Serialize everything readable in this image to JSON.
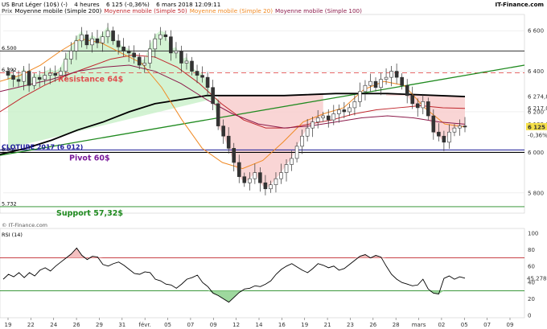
{
  "header": {
    "instrument": "US Brut Léger (10$) (-)",
    "timeframe": "4 heures",
    "price_change": "6 125 (-0,36%)",
    "datetime": "6 mars 2018 12:09:11",
    "source": "IT-Finance.com",
    "legend": [
      {
        "text": "Prix",
        "color": "#333333"
      },
      {
        "text": "Moyenne mobile (Simple 200)",
        "color": "#000000"
      },
      {
        "text": "Moyenne mobile (Simple 50)",
        "color": "#c0272d"
      },
      {
        "text": "Moyenne mobile (Simple 20)",
        "color": "#f08a24"
      },
      {
        "text": "Moyenne mobile (Simple 100)",
        "color": "#8b1a4a"
      }
    ]
  },
  "colors": {
    "candle": "#333333",
    "sma200": "#000000",
    "sma50": "#c0272d",
    "sma20": "#f08a24",
    "sma100": "#8b1a4a",
    "trendline": "#1f8a1f",
    "support": "#1f8a1f",
    "resistance": "#e05050",
    "pivot": "#1a1a9a",
    "green_fill": "#c8f0c8",
    "red_fill": "#f8d0d0"
  },
  "chart_data": [
    {
      "type": "candlestick",
      "title": "",
      "ylim": [
        5.7,
        6.68
      ],
      "y_ticks": [
        6.6,
        6.4,
        6.2,
        6.0,
        5.8
      ],
      "y_tick_labels": [
        "6 600",
        "6 400",
        "6 200",
        "6 000",
        "5 800"
      ],
      "x_tick_labels": [
        "19",
        "22",
        "24",
        "26",
        "29",
        "31",
        "févr.",
        "05",
        "07",
        "09",
        "12",
        "14",
        "16",
        "19",
        "21",
        "23",
        "26",
        "28",
        "mars",
        "02",
        "05",
        "07",
        "09"
      ],
      "levels": [
        {
          "name": "level-6500",
          "y": 6.5,
          "label": "6.500",
          "style": "solid",
          "color": "#333333"
        },
        {
          "name": "level-resistance",
          "y": 6.392,
          "label": "6.392",
          "annotation": "Résistance 64$",
          "style": "dashed",
          "color": "#e05050"
        },
        {
          "name": "level-cloture",
          "y": 6.012,
          "annotation": "CLOTURE 2017 (6 012)",
          "style": "solid",
          "color": "#1a1a9a"
        },
        {
          "name": "level-pivot",
          "y": 6.0,
          "label": "6.000",
          "annotation": "Pivot 60$",
          "style": "solid",
          "color": "#000000"
        },
        {
          "name": "level-support",
          "y": 5.732,
          "label": "5.732",
          "annotation": "Support 57,32$",
          "style": "solid",
          "color": "#1f8a1f"
        }
      ],
      "right_labels": [
        {
          "text": "6 274,8",
          "y": 6.2748,
          "color": "#000000"
        },
        {
          "text": "6 217,0",
          "y": 6.217,
          "color": "#c0272d"
        },
        {
          "text": "6 139,1",
          "y": 6.1391,
          "color": "#8b1a4a"
        },
        {
          "text": "6 125",
          "y": 6.125,
          "color": "#000000",
          "bg": "#f5e04a"
        },
        {
          "text": "-0,36%",
          "y": 6.085,
          "color": "#c0272d"
        }
      ],
      "trendline": [
        [
          0,
          5.985
        ],
        [
          1,
          6.43
        ]
      ],
      "series": [
        {
          "name": "Prix",
          "close": [
            6.38,
            6.36,
            6.35,
            6.4,
            6.33,
            6.37,
            6.36,
            6.38,
            6.39,
            6.38,
            6.4,
            6.46,
            6.5,
            6.55,
            6.58,
            6.53,
            6.56,
            6.54,
            6.57,
            6.6,
            6.55,
            6.52,
            6.5,
            6.49,
            6.47,
            6.43,
            6.44,
            6.51,
            6.56,
            6.58,
            6.57,
            6.49,
            6.5,
            6.44,
            6.45,
            6.4,
            6.38,
            6.37,
            6.32,
            6.24,
            6.13,
            6.08,
            6.02,
            5.95,
            5.88,
            5.85,
            5.87,
            5.9,
            5.85,
            5.82,
            5.84,
            5.87,
            5.9,
            5.94,
            5.97,
            6.03,
            6.08,
            6.12,
            6.15,
            6.17,
            6.18,
            6.16,
            6.19,
            6.21,
            6.2,
            6.22,
            6.25,
            6.3,
            6.33,
            6.35,
            6.32,
            6.36,
            6.37,
            6.4,
            6.37,
            6.33,
            6.28,
            6.24,
            6.22,
            6.25,
            6.18,
            6.1,
            6.08,
            6.05,
            6.1,
            6.12,
            6.13,
            6.125
          ]
        },
        {
          "name": "Moyenne mobile (Simple 200)",
          "values": [
            5.99,
            6.02,
            6.06,
            6.11,
            6.15,
            6.2,
            6.24,
            6.26,
            6.28,
            6.28,
            6.28,
            6.28,
            6.285,
            6.29,
            6.29,
            6.29,
            6.285,
            6.28,
            6.275
          ]
        },
        {
          "name": "Moyenne mobile (Simple 50)",
          "values": [
            6.2,
            6.27,
            6.33,
            6.38,
            6.42,
            6.46,
            6.48,
            6.47,
            6.42,
            6.34,
            6.24,
            6.16,
            6.12,
            6.12,
            6.14,
            6.16,
            6.19,
            6.21,
            6.22,
            6.23,
            6.22,
            6.217
          ]
        },
        {
          "name": "Moyenne mobile (Simple 20)",
          "values": [
            6.35,
            6.38,
            6.43,
            6.5,
            6.56,
            6.54,
            6.49,
            6.44,
            6.32,
            6.16,
            6.02,
            5.95,
            5.92,
            5.96,
            6.05,
            6.15,
            6.19,
            6.22,
            6.31,
            6.35,
            6.33,
            6.22,
            6.14,
            6.125
          ]
        },
        {
          "name": "Moyenne mobile (Simple 100)",
          "values": [
            6.3,
            6.33,
            6.36,
            6.4,
            6.42,
            6.43,
            6.4,
            6.34,
            6.26,
            6.19,
            6.14,
            6.12,
            6.13,
            6.15,
            6.17,
            6.18,
            6.17,
            6.15,
            6.139
          ]
        }
      ]
    },
    {
      "type": "line",
      "title": "RSI (14)",
      "ylim": [
        0,
        100
      ],
      "y_ticks": [
        100,
        80,
        60,
        40,
        20,
        0
      ],
      "y_tick_labels": [
        "100",
        "80",
        "60",
        "40",
        "20",
        "0"
      ],
      "overbought": 70,
      "oversold": 30,
      "last_value_label": "45,278",
      "series": [
        {
          "name": "RSI",
          "values": [
            44,
            50,
            47,
            52,
            46,
            52,
            48,
            55,
            58,
            54,
            60,
            65,
            70,
            75,
            82,
            73,
            68,
            72,
            71,
            62,
            60,
            63,
            65,
            61,
            56,
            51,
            50,
            53,
            52,
            44,
            42,
            38,
            37,
            33,
            38,
            44,
            46,
            49,
            40,
            35,
            27,
            24,
            20,
            16,
            22,
            28,
            32,
            33,
            36,
            35,
            38,
            42,
            50,
            56,
            60,
            63,
            59,
            55,
            52,
            57,
            63,
            61,
            58,
            60,
            55,
            57,
            62,
            67,
            72,
            74,
            70,
            73,
            71,
            60,
            50,
            44,
            40,
            38,
            36,
            37,
            44,
            32,
            27,
            26,
            45,
            48,
            44,
            47,
            45.3
          ]
        }
      ]
    }
  ],
  "footer_source": "© IT-Finance.com"
}
